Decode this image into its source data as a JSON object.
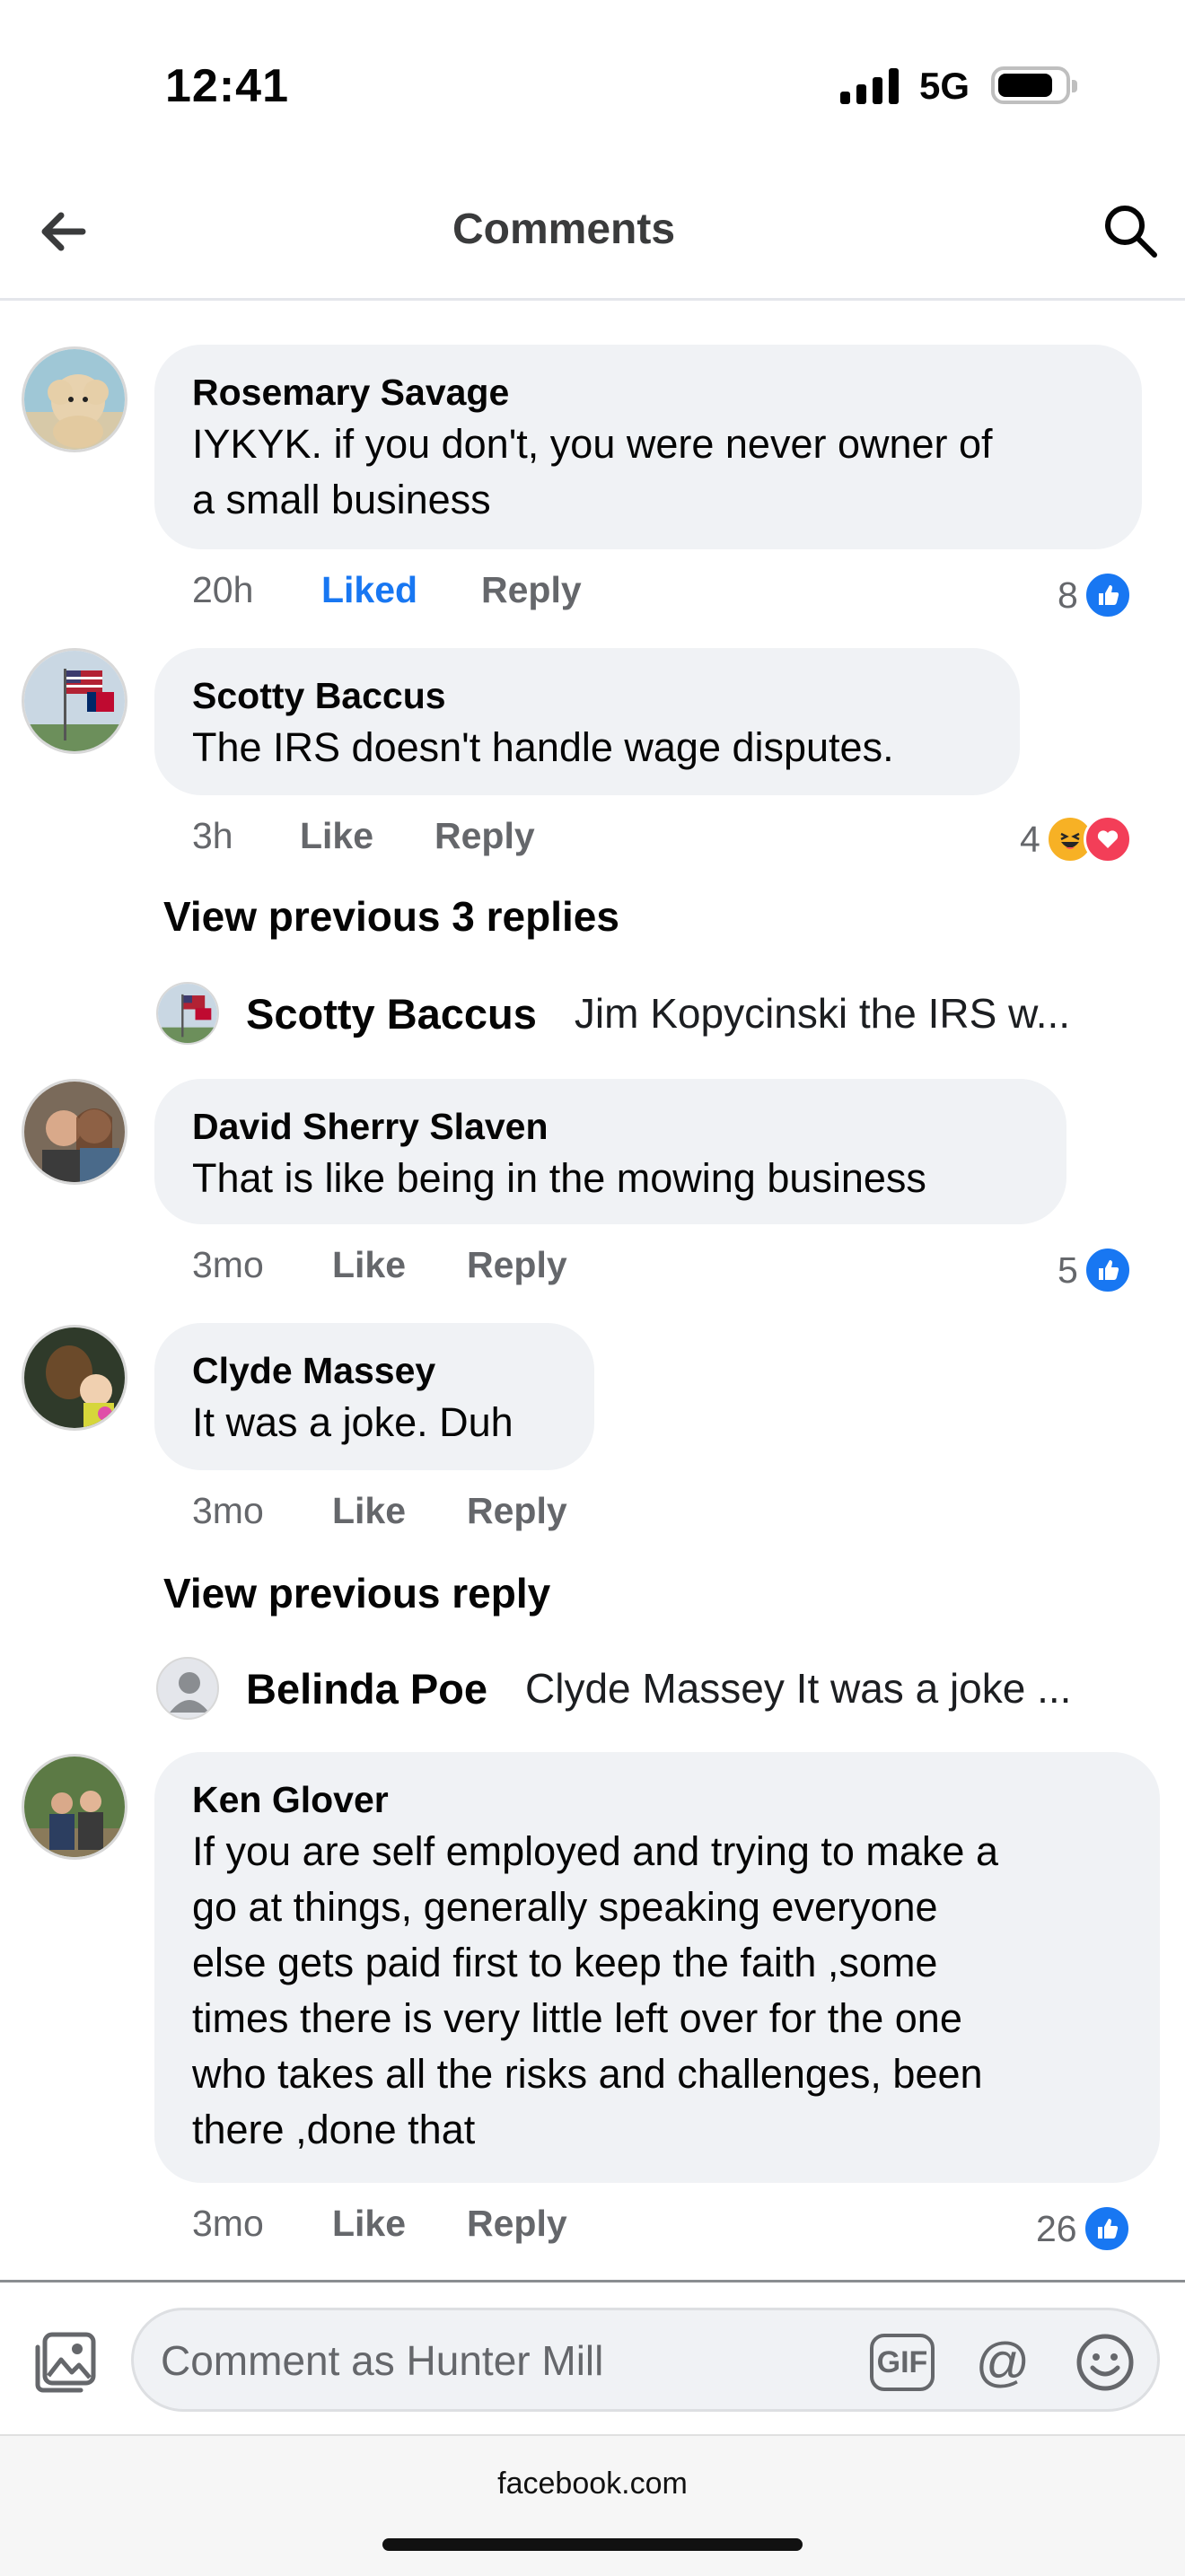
{
  "status_bar": {
    "time": "12:41",
    "network": "5G"
  },
  "header": {
    "title": "Comments"
  },
  "comments": [
    {
      "author": "Rosemary Savage",
      "text_lines": [
        "IYKYK. if you don't, you were never owner of",
        "a small business"
      ],
      "time": "20h",
      "like_label": "Liked",
      "reply_label": "Reply",
      "reaction_count": "8"
    },
    {
      "author": "Scotty Baccus",
      "text_lines": [
        "The IRS doesn't handle wage disputes."
      ],
      "time": "3h",
      "like_label": "Like",
      "reply_label": "Reply",
      "reaction_count": "4",
      "view_previous": "View previous 3 replies",
      "reply_preview": {
        "author": "Scotty Baccus",
        "text": "Jim Kopycinski the IRS w..."
      }
    },
    {
      "author": "David Sherry Slaven",
      "text_lines": [
        "That is like being in the mowing business"
      ],
      "time": "3mo",
      "like_label": "Like",
      "reply_label": "Reply",
      "reaction_count": "5"
    },
    {
      "author": "Clyde Massey",
      "text_lines": [
        "It was a joke. Duh"
      ],
      "time": "3mo",
      "like_label": "Like",
      "reply_label": "Reply",
      "view_previous": "View previous reply",
      "reply_preview": {
        "author": "Belinda Poe",
        "text": "Clyde Massey It was a joke ..."
      }
    },
    {
      "author": "Ken Glover",
      "text_lines": [
        "If you are self employed and trying to make a",
        "go at things, generally speaking everyone",
        "else gets paid first to keep the faith ,some",
        "times there is very little left over for the one",
        "who takes all the risks and challenges, been",
        "there ,done that"
      ],
      "time": "3mo",
      "like_label": "Like",
      "reply_label": "Reply",
      "reaction_count": "26"
    }
  ],
  "composer": {
    "placeholder": "Comment as Hunter Mill",
    "gif_label": "GIF",
    "at_label": "@"
  },
  "browser": {
    "url": "facebook.com"
  },
  "colors": {
    "accent": "#1877f2",
    "bubble": "#f0f2f5",
    "secondary_text": "#65676b"
  },
  "icons": [
    "back-arrow-icon",
    "search-icon",
    "like-icon",
    "haha-icon",
    "love-icon",
    "photo-icon",
    "emoji-icon",
    "default-avatar-icon"
  ]
}
